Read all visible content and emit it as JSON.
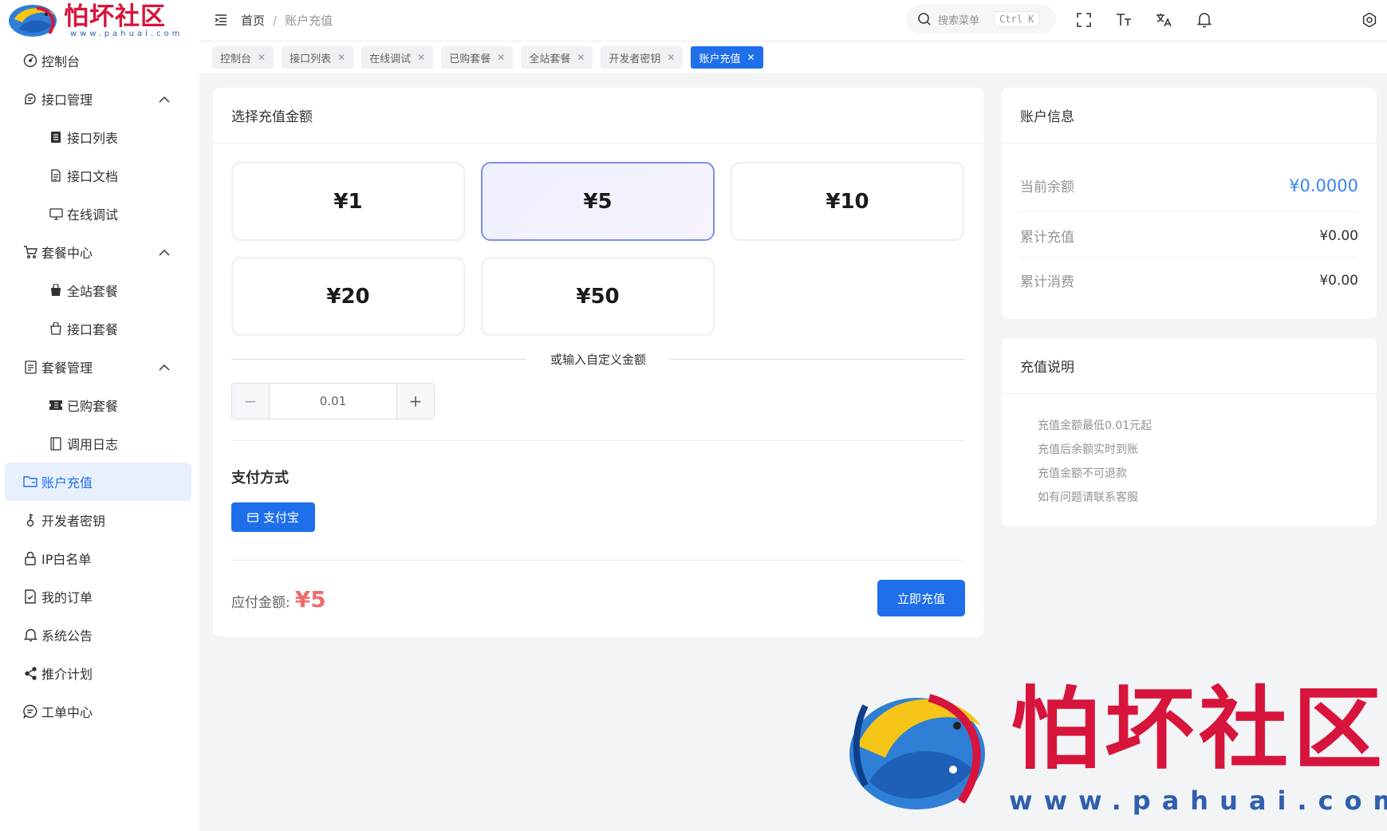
{
  "brand": {
    "name": "怕坏社区",
    "url": "www.pahuai.com"
  },
  "sidebar": {
    "items": [
      {
        "label": "控制台",
        "icon": "dashboard-icon",
        "level": 1
      },
      {
        "label": "接口管理",
        "icon": "api-manage-icon",
        "level": 1,
        "expanded": true
      },
      {
        "label": "接口列表",
        "icon": "list-icon",
        "level": 2
      },
      {
        "label": "接口文档",
        "icon": "doc-icon",
        "level": 2
      },
      {
        "label": "在线调试",
        "icon": "monitor-icon",
        "level": 2
      },
      {
        "label": "套餐中心",
        "icon": "cart-icon",
        "level": 1,
        "expanded": true
      },
      {
        "label": "全站套餐",
        "icon": "bag-filled-icon",
        "level": 2
      },
      {
        "label": "接口套餐",
        "icon": "bag-icon",
        "level": 2
      },
      {
        "label": "套餐管理",
        "icon": "package-manage-icon",
        "level": 1,
        "expanded": true
      },
      {
        "label": "已购套餐",
        "icon": "ticket-icon",
        "level": 2
      },
      {
        "label": "调用日志",
        "icon": "log-icon",
        "level": 2
      },
      {
        "label": "账户充值",
        "icon": "folder-icon",
        "level": 1,
        "active": true
      },
      {
        "label": "开发者密钥",
        "icon": "key-icon",
        "level": 1
      },
      {
        "label": "IP白名单",
        "icon": "lock-icon",
        "level": 1
      },
      {
        "label": "我的订单",
        "icon": "order-icon",
        "level": 1
      },
      {
        "label": "系统公告",
        "icon": "bell-icon",
        "level": 1
      },
      {
        "label": "推介计划",
        "icon": "share-icon",
        "level": 1
      },
      {
        "label": "工单中心",
        "icon": "chat-icon",
        "level": 1
      }
    ]
  },
  "header": {
    "breadcrumb_home": "首页",
    "breadcrumb_sep": "/",
    "breadcrumb_current": "账户充值",
    "search_placeholder": "搜索菜单",
    "search_shortcut": "Ctrl K"
  },
  "tabs": [
    {
      "label": "控制台"
    },
    {
      "label": "接口列表"
    },
    {
      "label": "在线调试"
    },
    {
      "label": "已购套餐"
    },
    {
      "label": "全站套餐"
    },
    {
      "label": "开发者密钥"
    },
    {
      "label": "账户充值",
      "active": true
    }
  ],
  "recharge": {
    "title": "选择充值金额",
    "amounts": [
      "¥1",
      "¥5",
      "¥10",
      "¥20",
      "¥50"
    ],
    "selected_index": 1,
    "custom_label": "或输入自定义金额",
    "custom_value": "0.01",
    "minus": "−",
    "plus": "+",
    "pay_method_title": "支付方式",
    "alipay_label": "支付宝",
    "due_label": "应付金额:",
    "due_value": "¥5",
    "submit_label": "立即充值"
  },
  "account": {
    "title": "账户信息",
    "balance_label": "当前余额",
    "balance_value": "¥0.0000",
    "total_recharge_label": "累计充值",
    "total_recharge_value": "¥0.00",
    "total_spend_label": "累计消费",
    "total_spend_value": "¥0.00"
  },
  "notes": {
    "title": "充值说明",
    "items": [
      "充值金额最低0.01元起",
      "充值后余额实时到账",
      "充值金额不可退款",
      "如有问题请联系客服"
    ]
  },
  "colors": {
    "primary": "#1f6feb",
    "brand_red": "#d7143c",
    "brand_blue": "#2f5fae",
    "due_red": "#f06b6b"
  }
}
